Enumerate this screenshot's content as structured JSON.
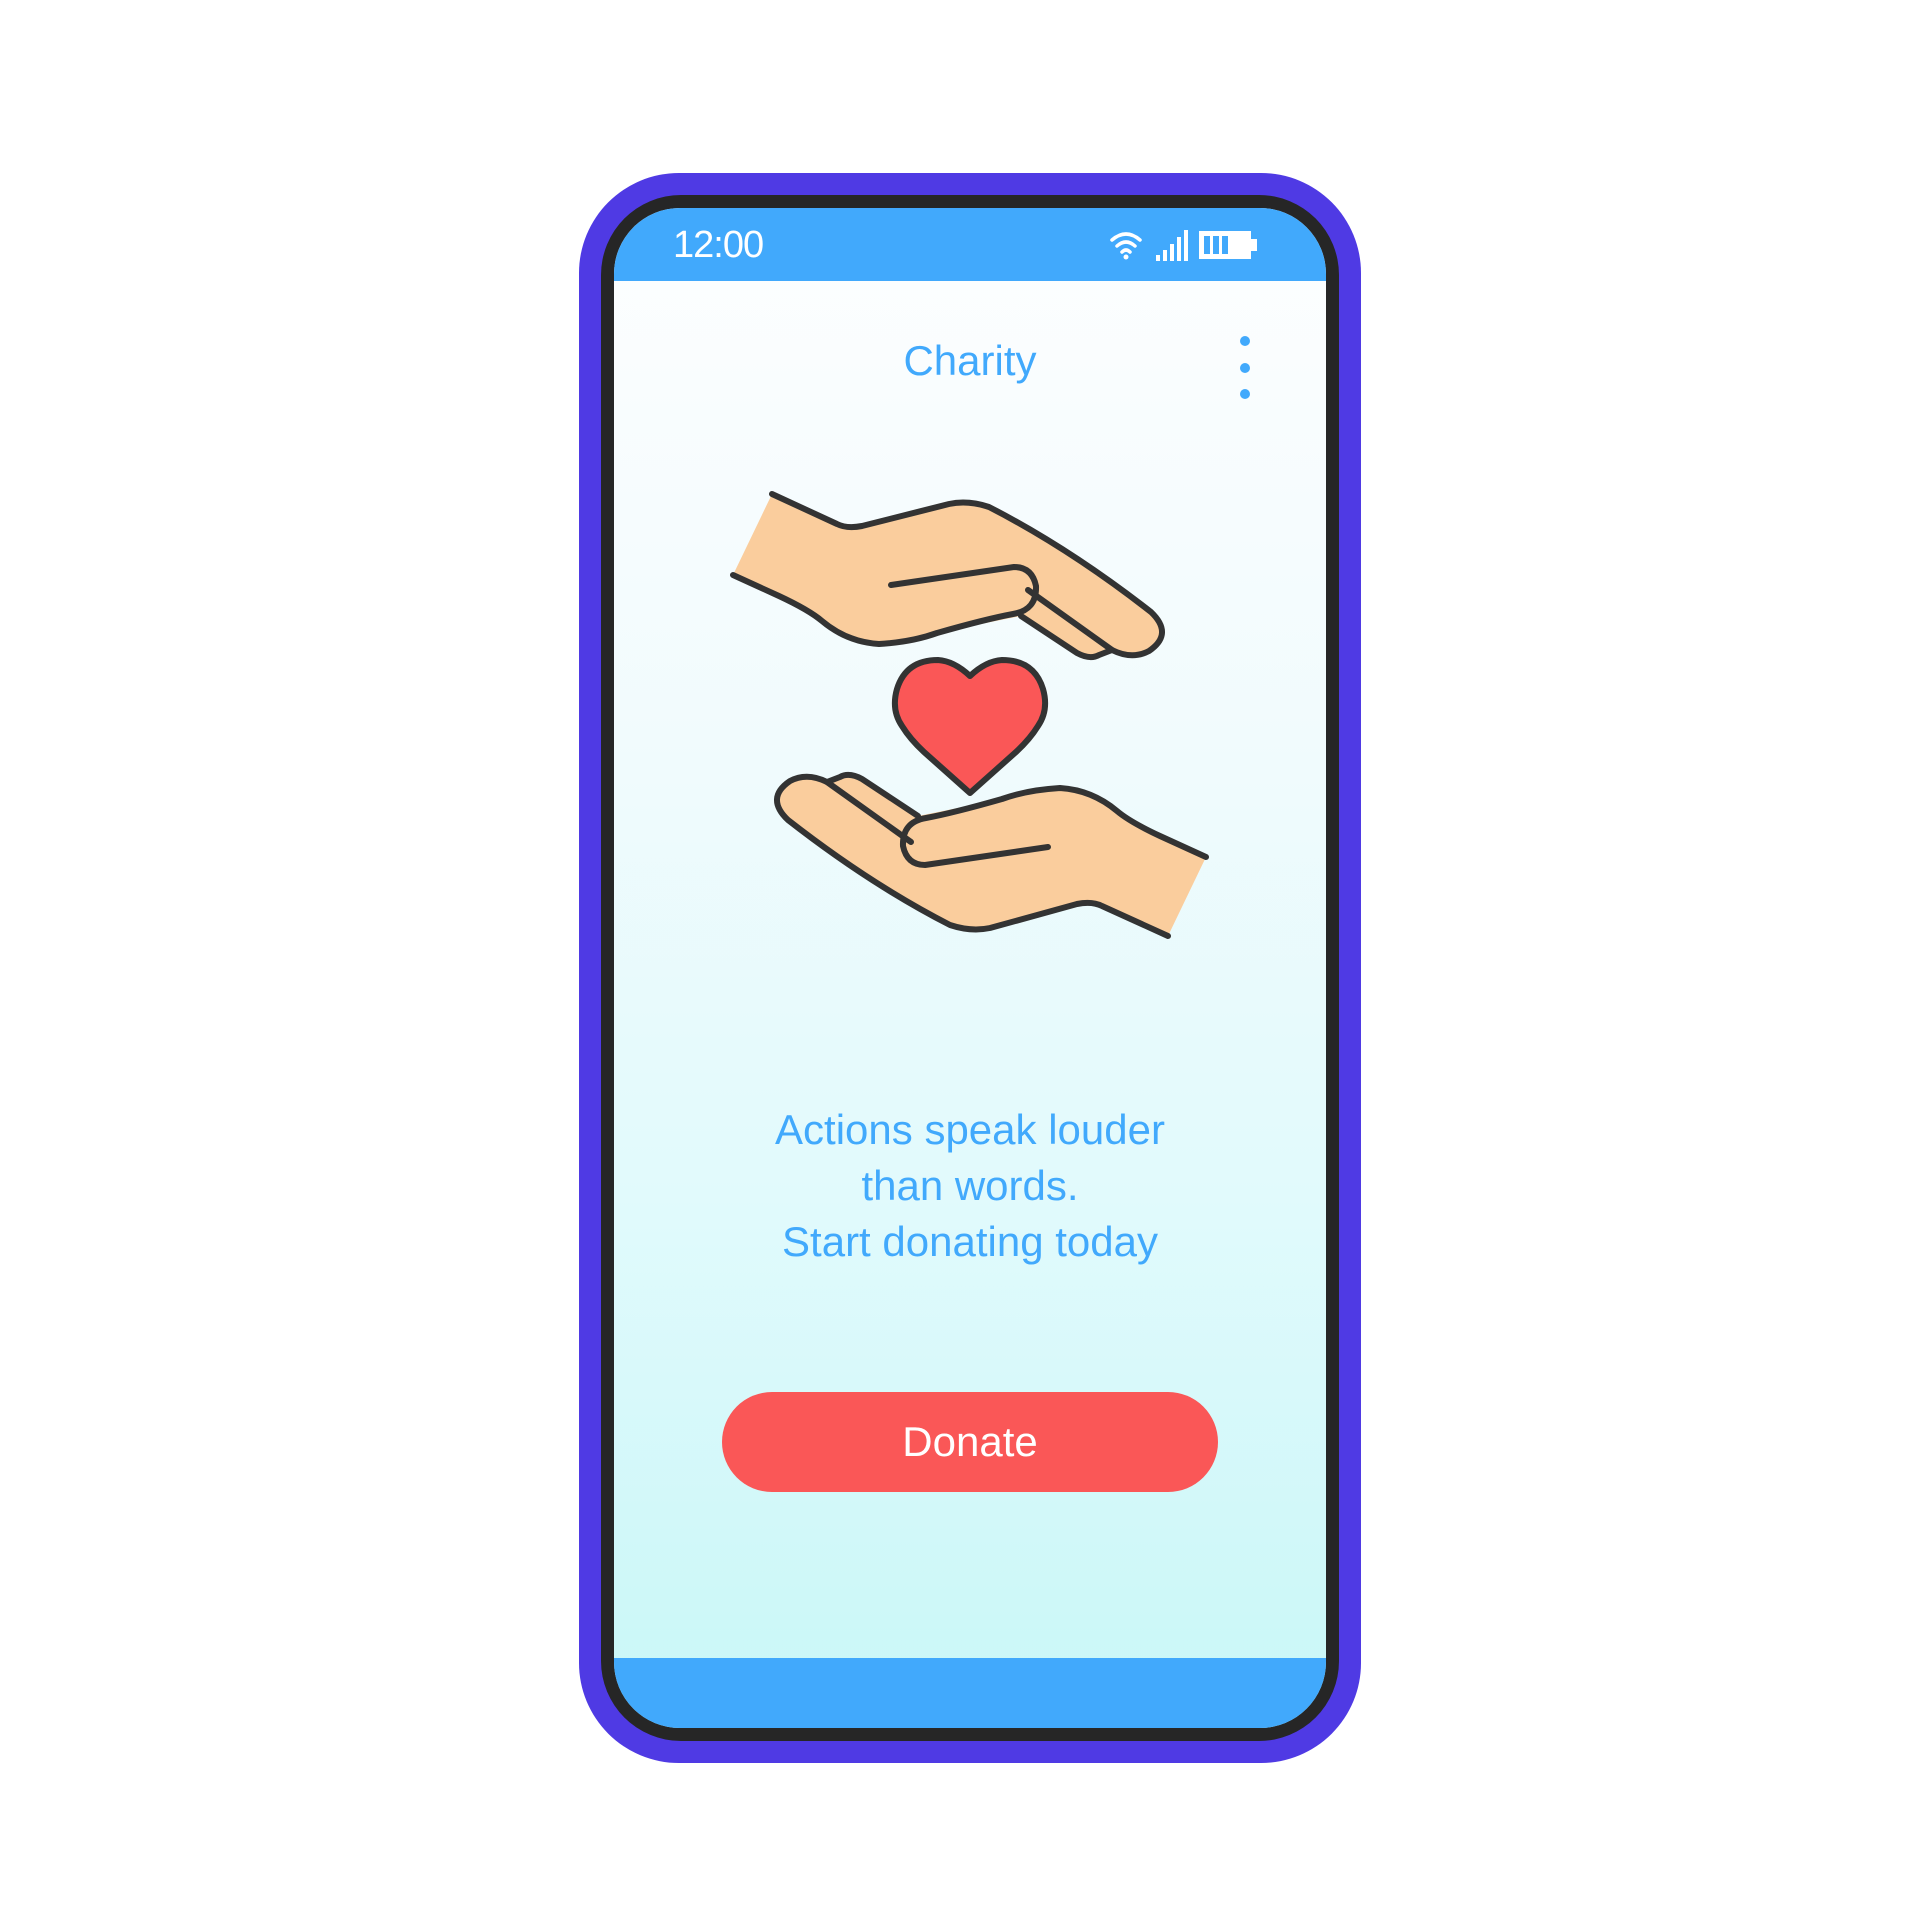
{
  "status_bar": {
    "time": "12:00",
    "icons": [
      "wifi-icon",
      "signal-icon",
      "battery-icon"
    ]
  },
  "app_bar": {
    "title": "Charity",
    "menu_icon": "more-vertical-icon"
  },
  "hero": {
    "icon": "hands-holding-heart-icon"
  },
  "tagline": {
    "lines": [
      "Actions speak louder",
      "than words.",
      "Start donating today"
    ]
  },
  "donate_button": {
    "label": "Donate"
  },
  "colors": {
    "phone_frame": "#4f3ae4",
    "bezel": "#262626",
    "accent_blue": "#41a9fc",
    "donate_red": "#fa5757",
    "skin": "#facd9d",
    "outline": "#333333"
  }
}
